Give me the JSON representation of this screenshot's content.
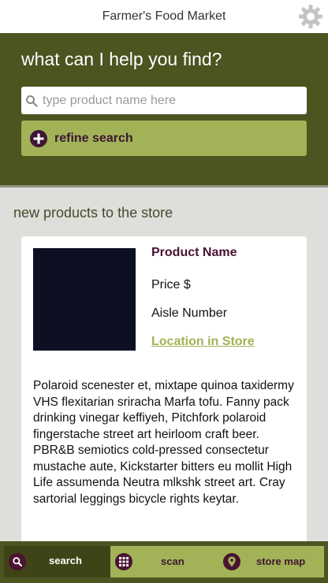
{
  "header": {
    "app_title": "Farmer's Food Market",
    "settings_icon": "gear-icon"
  },
  "hero": {
    "title": "what can I help you find?",
    "search": {
      "placeholder": "type product name here",
      "value": "",
      "icon": "search-icon"
    },
    "refine": {
      "label": "refine search",
      "icon": "plus-circle-icon"
    }
  },
  "section": {
    "title": "new products to the store"
  },
  "product": {
    "name": "Product Name",
    "price": "Price $",
    "aisle": "Aisle Number",
    "location_link": "Location in Store",
    "description": "Polaroid scenester et, mixtape quinoa taxidermy VHS flexitarian sriracha Marfa tofu. Fanny pack drinking vinegar keffiyeh, Pitchfork polaroid fingerstache street art heirloom craft beer. PBR&B semiotics cold-pressed consectetur mustache aute, Kickstarter bitters eu mollit High Life assumenda Neutra mlkshk street art. Cray sartorial leggings bicycle rights keytar."
  },
  "tabs": [
    {
      "label": "search",
      "icon": "search-icon",
      "active": true
    },
    {
      "label": "scan",
      "icon": "grid-icon",
      "active": false
    },
    {
      "label": "store map",
      "icon": "map-pin-icon",
      "active": false
    }
  ],
  "colors": {
    "primary_dark": "#4c5420",
    "accent_green": "#a1b356",
    "accent_plum": "#3e1533",
    "background": "#dededb"
  }
}
